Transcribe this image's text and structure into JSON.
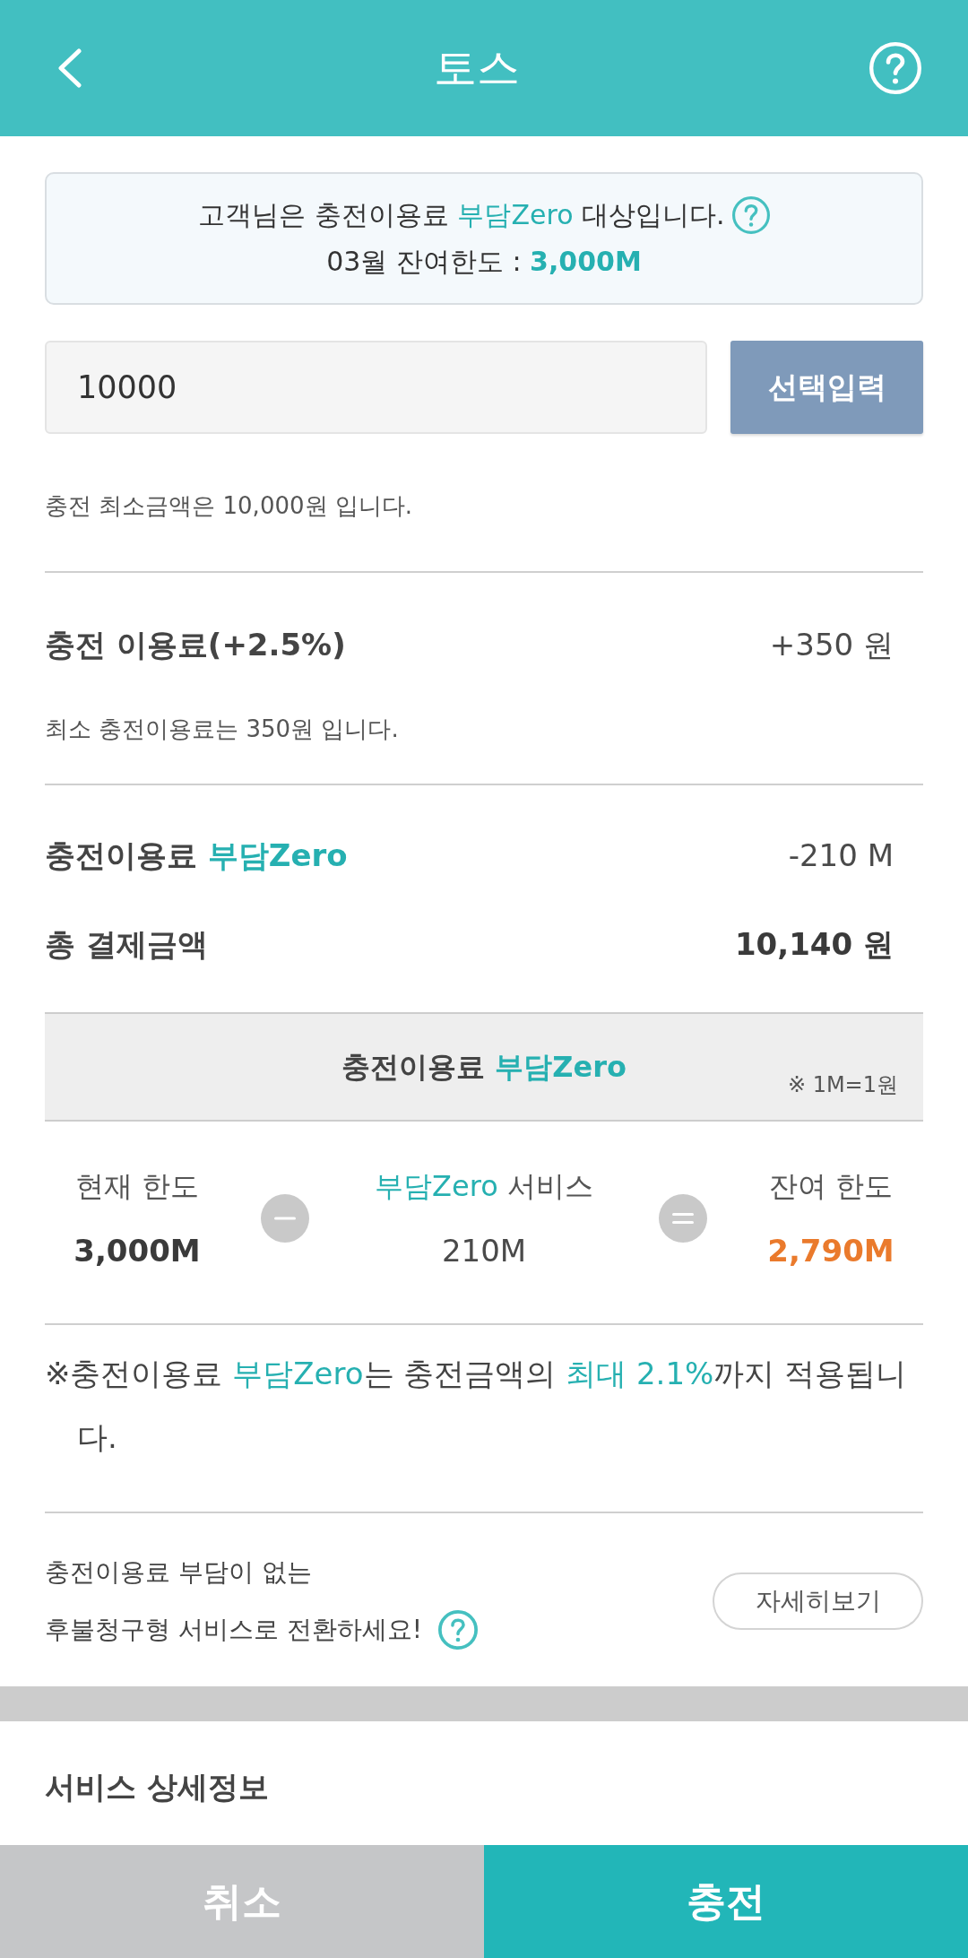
{
  "header": {
    "title": "토스"
  },
  "notice": {
    "lines": [
      [
        {
          "text": "고객님은 충전이용료 ",
          "highlight": false
        },
        {
          "text": "부담Zero",
          "highlight": true
        },
        {
          "text": " 대상입니다.",
          "highlight": false
        }
      ],
      [
        {
          "text": "03월 잔여한도 : ",
          "highlight": false
        },
        {
          "text": "**3,000M**",
          "highlight": true
        }
      ]
    ]
  },
  "amount": {
    "value": "10000",
    "button": "선택입력",
    "hint": "충전 최소금액은 10,000원 입니다."
  },
  "sections": [
    {
      "rows": [
        {
          "label": [
            {
              "text": "충전 이용료(+2.5%)",
              "highlight": false
            }
          ],
          "value": "+350 원",
          "bold": false
        }
      ],
      "note": "최소 충전이용료는 350원 입니다."
    },
    {
      "rows": [
        {
          "label": [
            {
              "text": "충전이용료 ",
              "highlight": false
            },
            {
              "text": "부담Zero",
              "highlight": true
            }
          ],
          "value": "-210 M",
          "bold": false
        },
        {
          "label": [
            {
              "text": "총 결제금액",
              "highlight": false
            }
          ],
          "value": "10,140 원",
          "bold": true
        }
      ]
    }
  ],
  "zero_panel": {
    "title": [
      {
        "text": "충전이용료 ",
        "highlight": false
      },
      {
        "text": "부담Zero",
        "highlight": true
      }
    ],
    "unit_note": "※ 1M=1원",
    "formula": [
      {
        "kind": "term",
        "label": [
          {
            "text": "현재 한도",
            "highlight": false
          }
        ],
        "value": "3,000M",
        "bold": true,
        "alert": false
      },
      {
        "kind": "minus"
      },
      {
        "kind": "term",
        "label": [
          {
            "text": "부담Zero",
            "highlight": true
          },
          {
            "text": " 서비스",
            "highlight": false
          }
        ],
        "value": "210M",
        "bold": false,
        "alert": false
      },
      {
        "kind": "equals"
      },
      {
        "kind": "term",
        "label": [
          {
            "text": "잔여 한도",
            "highlight": false
          }
        ],
        "value": "2,790M",
        "bold": true,
        "alert": true
      }
    ]
  },
  "policy_note": [
    {
      "text": "※충전이용료 ",
      "highlight": false
    },
    {
      "text": "부담Zero",
      "highlight": true
    },
    {
      "text": "는 충전금액의 ",
      "highlight": false
    },
    {
      "text": "최대 2.1%",
      "highlight": true
    },
    {
      "text": "까지 적용됩니다.",
      "highlight": false
    }
  ],
  "promo": {
    "lines": [
      "충전이용료 부담이 없는",
      "후불청구형 서비스로 전환하세요!"
    ],
    "button": "자세히보기"
  },
  "details": {
    "title": "서비스 상세정보"
  },
  "actions": [
    {
      "label": "취소",
      "kind": "cancel"
    },
    {
      "label": "충전",
      "kind": "confirm"
    }
  ]
}
